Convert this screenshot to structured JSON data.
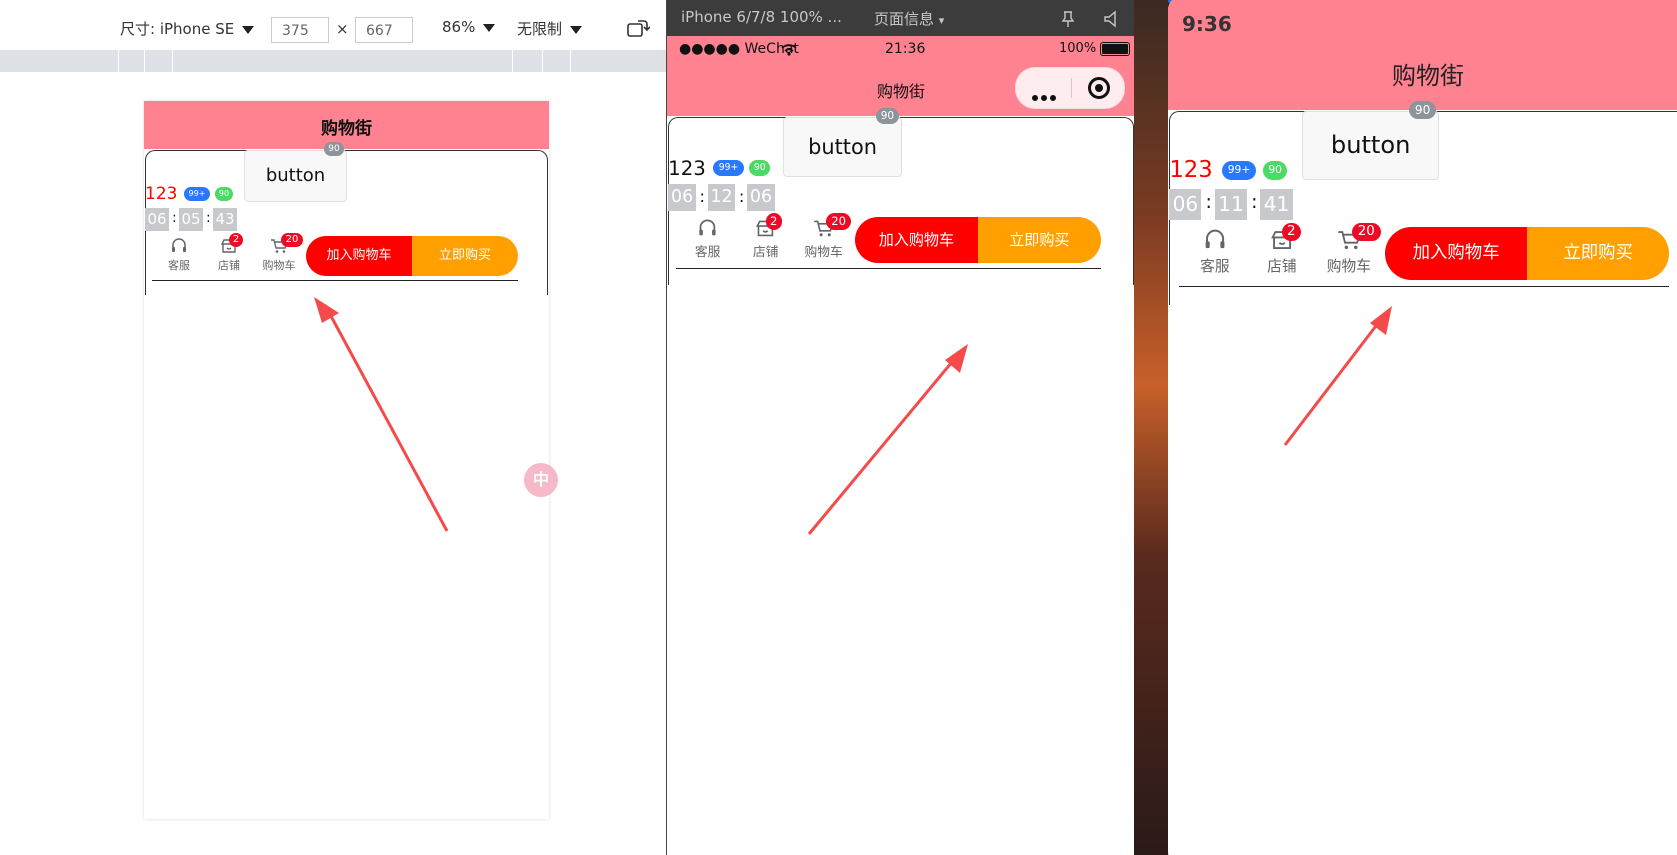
{
  "browser": {
    "size_label": "尺寸: iPhone SE",
    "width_value": "375",
    "times": "×",
    "height_value": "667",
    "zoom": "86%",
    "throttle": "无限制",
    "float_char": "中"
  },
  "wechat": {
    "device": "iPhone 6/7/8 100% ...",
    "page_info": "页面信息",
    "page_info_caret": "▾",
    "carrier": "●●●●● WeChat",
    "time": "21:36",
    "battery": "100%"
  },
  "device": {
    "time": "9:36"
  },
  "page": {
    "title": "购物街",
    "button_label": "button",
    "button_badge": "90",
    "number": "123",
    "badge_blue": "99+",
    "badge_green": "90",
    "colon": ":",
    "goods_action": {
      "icons": [
        {
          "label": "客服",
          "icon": "headset-icon",
          "badge": ""
        },
        {
          "label": "店铺",
          "icon": "shop-icon",
          "badge": "2"
        },
        {
          "label": "购物车",
          "icon": "cart-icon",
          "badge": "20"
        }
      ],
      "add_to_cart": "加入购物车",
      "buy_now": "立即购买"
    }
  },
  "countdowns": {
    "browser": [
      "06",
      "05",
      "43"
    ],
    "wechat": [
      "06",
      "12",
      "06"
    ],
    "device": [
      "06",
      "11",
      "41"
    ]
  },
  "colors": {
    "nav_pink": "#ff8290",
    "red": "#ff0000",
    "orange": "#ff9f00",
    "blue_badge": "#2979ff",
    "green_badge": "#4cd964",
    "grey_badge": "#8f939c",
    "arrow": "#f44a4a"
  }
}
